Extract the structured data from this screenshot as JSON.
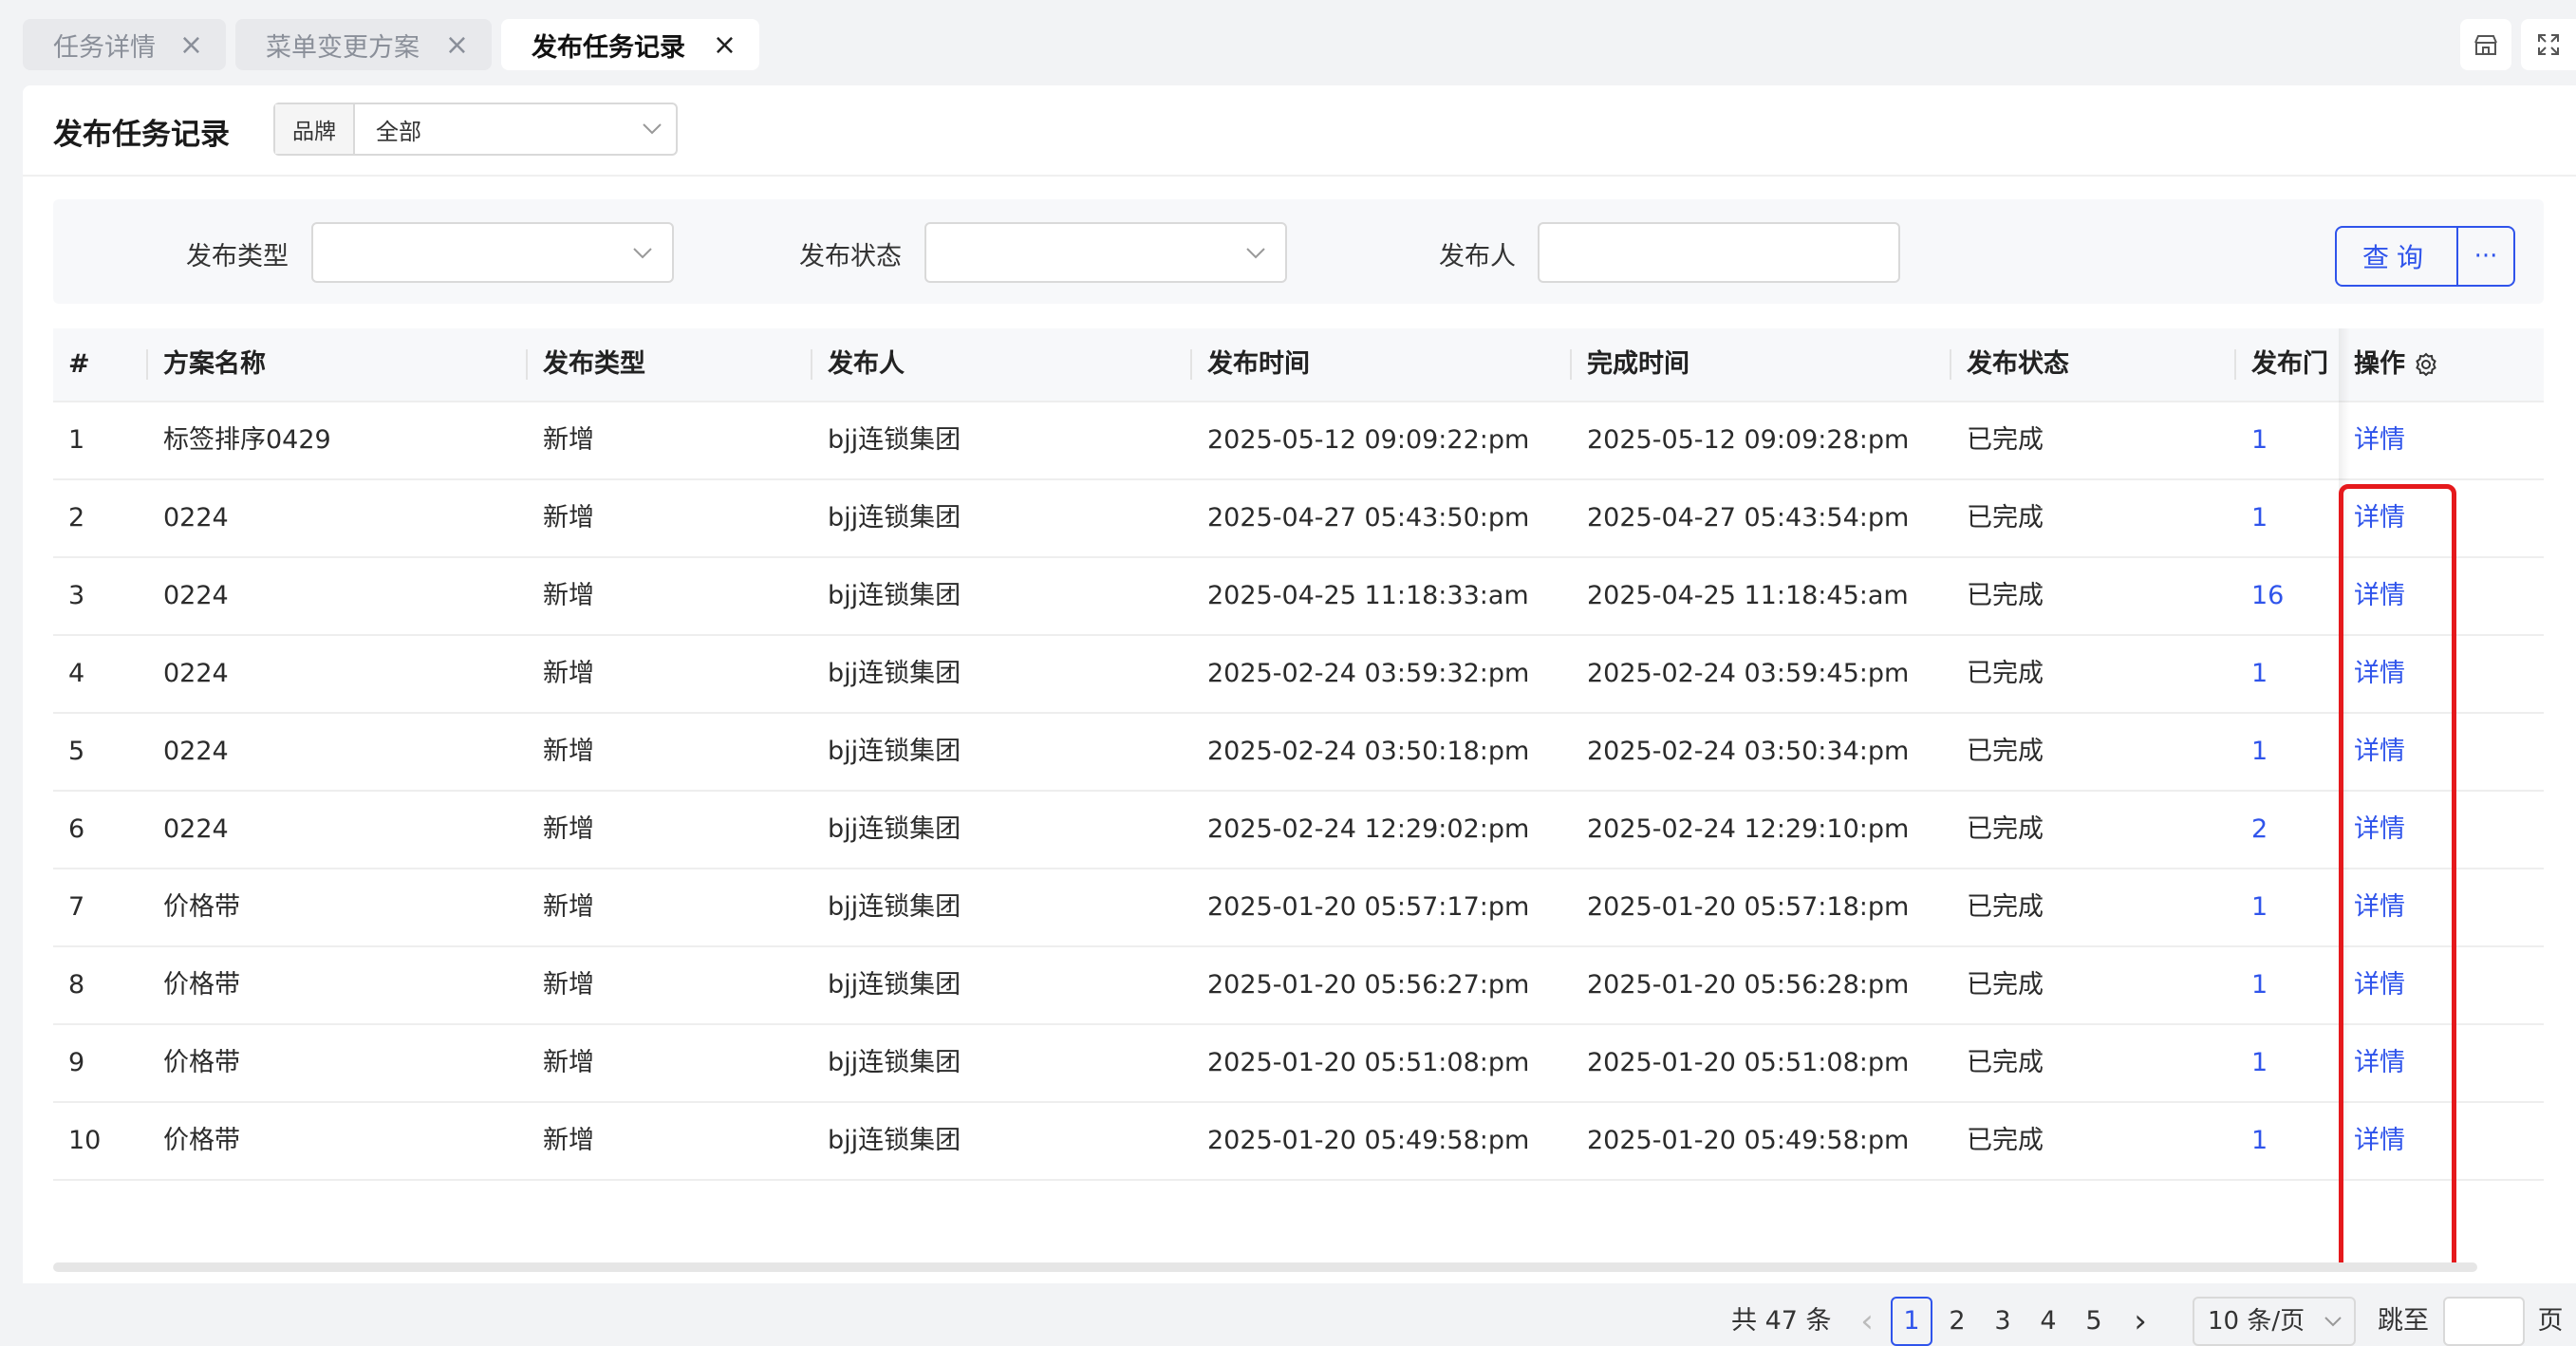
{
  "tabs": [
    {
      "label": "任务详情",
      "active": false
    },
    {
      "label": "菜单变更方案",
      "active": false
    },
    {
      "label": "发布任务记录",
      "active": true
    }
  ],
  "tab_close_glyph": "×",
  "page_title": "发布任务记录",
  "brand": {
    "label": "品牌",
    "value": "全部"
  },
  "filters": {
    "publish_type_label": "发布类型",
    "publish_status_label": "发布状态",
    "publisher_label": "发布人",
    "publish_type_value": "",
    "publish_status_value": "",
    "publisher_value": ""
  },
  "buttons": {
    "query": "查询",
    "more": "···"
  },
  "table": {
    "headers": [
      "#",
      "方案名称",
      "发布类型",
      "发布人",
      "发布时间",
      "完成时间",
      "发布状态",
      "发布门",
      "操作"
    ],
    "rows": [
      [
        "1",
        "标签排序0429",
        "新增",
        "bjj连锁集团",
        "2025-05-12 09:09:22:pm",
        "2025-05-12 09:09:28:pm",
        "已完成",
        "1",
        "详情"
      ],
      [
        "2",
        "0224",
        "新增",
        "bjj连锁集团",
        "2025-04-27 05:43:50:pm",
        "2025-04-27 05:43:54:pm",
        "已完成",
        "1",
        "详情"
      ],
      [
        "3",
        "0224",
        "新增",
        "bjj连锁集团",
        "2025-04-25 11:18:33:am",
        "2025-04-25 11:18:45:am",
        "已完成",
        "16",
        "详情"
      ],
      [
        "4",
        "0224",
        "新增",
        "bjj连锁集团",
        "2025-02-24 03:59:32:pm",
        "2025-02-24 03:59:45:pm",
        "已完成",
        "1",
        "详情"
      ],
      [
        "5",
        "0224",
        "新增",
        "bjj连锁集团",
        "2025-02-24 03:50:18:pm",
        "2025-02-24 03:50:34:pm",
        "已完成",
        "1",
        "详情"
      ],
      [
        "6",
        "0224",
        "新增",
        "bjj连锁集团",
        "2025-02-24 12:29:02:pm",
        "2025-02-24 12:29:10:pm",
        "已完成",
        "2",
        "详情"
      ],
      [
        "7",
        "价格带",
        "新增",
        "bjj连锁集团",
        "2025-01-20 05:57:17:pm",
        "2025-01-20 05:57:18:pm",
        "已完成",
        "1",
        "详情"
      ],
      [
        "8",
        "价格带",
        "新增",
        "bjj连锁集团",
        "2025-01-20 05:56:27:pm",
        "2025-01-20 05:56:28:pm",
        "已完成",
        "1",
        "详情"
      ],
      [
        "9",
        "价格带",
        "新增",
        "bjj连锁集团",
        "2025-01-20 05:51:08:pm",
        "2025-01-20 05:51:08:pm",
        "已完成",
        "1",
        "详情"
      ],
      [
        "10",
        "价格带",
        "新增",
        "bjj连锁集团",
        "2025-01-20 05:49:58:pm",
        "2025-01-20 05:49:58:pm",
        "已完成",
        "1",
        "详情"
      ]
    ]
  },
  "pagination": {
    "total": "共 47 条",
    "prev": "‹",
    "next": "›",
    "pages": [
      "1",
      "2",
      "3",
      "4",
      "5"
    ],
    "current": "1",
    "page_size": "10 条/页",
    "jump_label": "跳至",
    "jump_suffix": "页"
  },
  "colors": {
    "accent": "#2f54eb",
    "highlight": "#e5191c"
  }
}
